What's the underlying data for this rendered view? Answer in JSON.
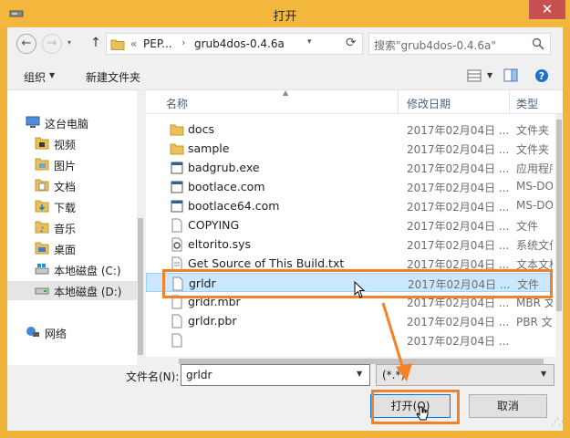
{
  "window": {
    "title": "打开",
    "close_symbol": "✕"
  },
  "nav": {
    "back_icon": "arrow-left-icon",
    "forward_icon": "arrow-right-icon",
    "up_icon": "arrow-up-icon",
    "breadcrumb": {
      "overflow": "«",
      "parent": "PEP...",
      "separator": "›",
      "current": "grub4dos-0.4.6a"
    }
  },
  "search": {
    "placeholder": "搜索\"grub4dos-0.4.6a\""
  },
  "toolbar": {
    "organize_label": "组织",
    "new_folder_label": "新建文件夹"
  },
  "sidebar": {
    "items": [
      {
        "label": "这台电脑",
        "icon": "computer-icon"
      },
      {
        "label": "视频",
        "icon": "folder-video-icon"
      },
      {
        "label": "图片",
        "icon": "folder-pictures-icon"
      },
      {
        "label": "文档",
        "icon": "folder-documents-icon"
      },
      {
        "label": "下载",
        "icon": "folder-download-icon"
      },
      {
        "label": "音乐",
        "icon": "folder-music-icon"
      },
      {
        "label": "桌面",
        "icon": "folder-desktop-icon"
      },
      {
        "label": "本地磁盘 (C:)",
        "icon": "drive-c-icon"
      },
      {
        "label": "本地磁盘 (D:)",
        "icon": "drive-d-icon",
        "selected": true
      },
      {
        "label": "网络",
        "icon": "network-icon"
      }
    ]
  },
  "columns": {
    "name": "名称",
    "date": "修改日期",
    "type": "类型"
  },
  "files": [
    {
      "name": "docs",
      "date": "2017年02月04日 ...",
      "type": "文件夹",
      "icon": "folder-icon"
    },
    {
      "name": "sample",
      "date": "2017年02月04日 ...",
      "type": "文件夹",
      "icon": "folder-icon"
    },
    {
      "name": "badgrub.exe",
      "date": "2017年02月04日 ...",
      "type": "应用程序",
      "icon": "exe-icon"
    },
    {
      "name": "bootlace.com",
      "date": "2017年02月04日 ...",
      "type": "MS-DOS",
      "icon": "exe-icon"
    },
    {
      "name": "bootlace64.com",
      "date": "2017年02月04日 ...",
      "type": "MS-DOS",
      "icon": "exe-icon"
    },
    {
      "name": "COPYING",
      "date": "2017年02月04日 ...",
      "type": "文件",
      "icon": "file-icon"
    },
    {
      "name": "eltorito.sys",
      "date": "2017年02月04日 ...",
      "type": "系统文件",
      "icon": "sys-file-icon"
    },
    {
      "name": "Get Source of This Build.txt",
      "date": "2017年02月04日 ...",
      "type": "文本文档",
      "icon": "text-file-icon"
    },
    {
      "name": "grldr",
      "date": "2017年02月04日 ...",
      "type": "文件",
      "icon": "file-icon",
      "selected": true
    },
    {
      "name": "grldr.mbr",
      "date": "2017年02月04日 ...",
      "type": "MBR 文件",
      "icon": "file-icon"
    },
    {
      "name": "grldr.pbr",
      "date": "2017年02月04日 ...",
      "type": "PBR 文件",
      "icon": "file-icon"
    },
    {
      "name": "",
      "date": "2017年02月04日 ...",
      "type": "",
      "icon": "file-icon"
    }
  ],
  "bottom": {
    "filename_label": "文件名(N):",
    "filename_value": "grldr",
    "filter_value": "(*.*)",
    "open_label": "打开(O)",
    "cancel_label": "取消"
  },
  "annotation_color": "#f58025"
}
